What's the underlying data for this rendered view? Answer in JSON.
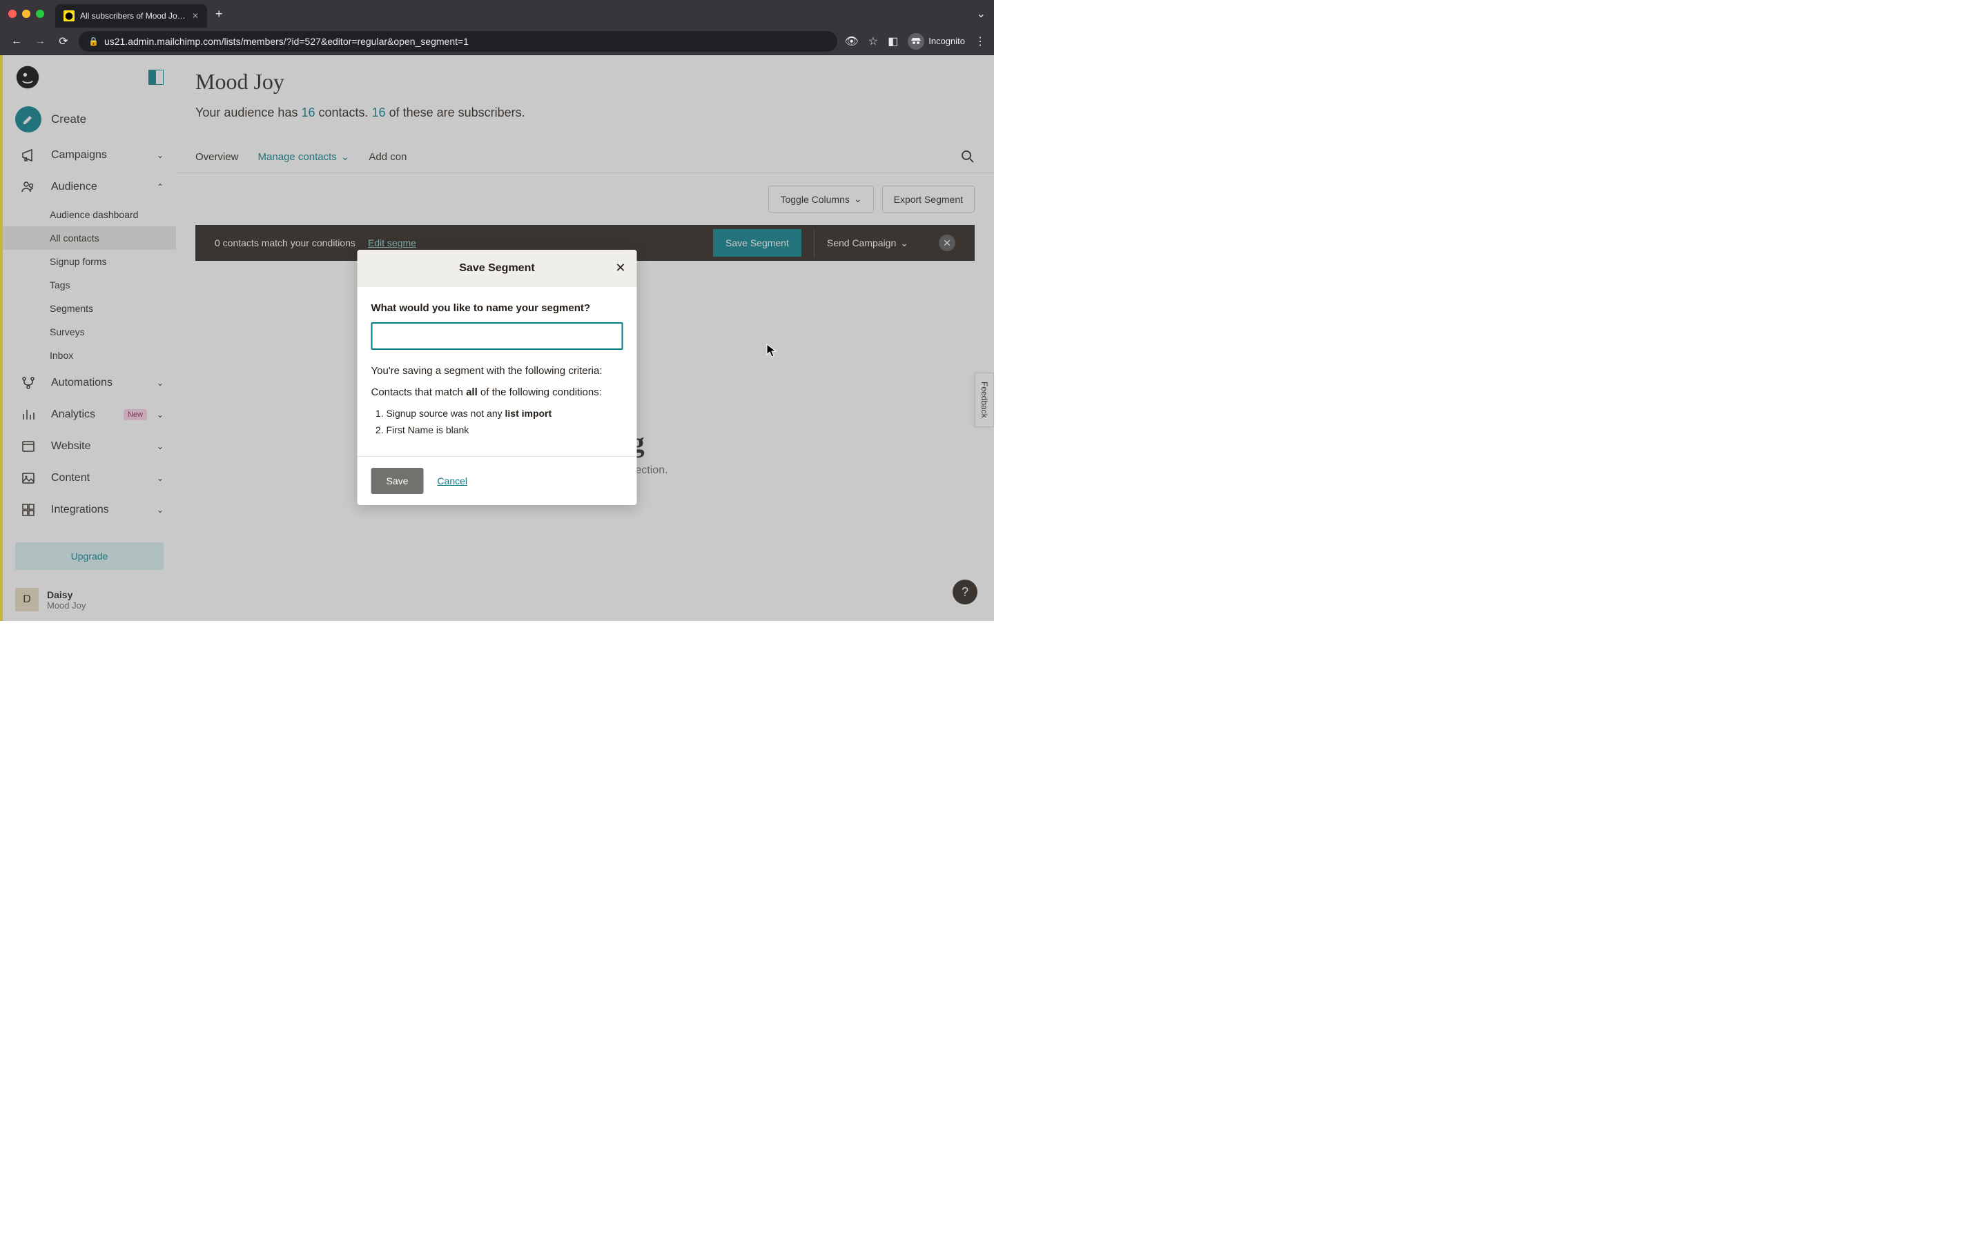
{
  "browser": {
    "tab_title": "All subscribers of Mood Joy | M",
    "url": "us21.admin.mailchimp.com/lists/members/?id=527&editor=regular&open_segment=1",
    "incognito_label": "Incognito"
  },
  "sidebar": {
    "create_label": "Create",
    "items": [
      {
        "label": "Campaigns"
      },
      {
        "label": "Audience"
      },
      {
        "label": "Automations"
      },
      {
        "label": "Analytics",
        "badge": "New"
      },
      {
        "label": "Website"
      },
      {
        "label": "Content"
      },
      {
        "label": "Integrations"
      }
    ],
    "audience_subnav": [
      {
        "label": "Audience dashboard"
      },
      {
        "label": "All contacts"
      },
      {
        "label": "Signup forms"
      },
      {
        "label": "Tags"
      },
      {
        "label": "Segments"
      },
      {
        "label": "Surveys"
      },
      {
        "label": "Inbox"
      }
    ],
    "upgrade_label": "Upgrade",
    "user_initial": "D",
    "user_name": "Daisy",
    "user_org": "Mood Joy"
  },
  "main": {
    "page_title": "Mood Joy",
    "audience_prefix": "Your audience has ",
    "contact_count": "16",
    "audience_mid": " contacts. ",
    "subscriber_count": "16",
    "audience_suffix": " of these are subscribers.",
    "tabs": {
      "overview": "Overview",
      "manage": "Manage contacts",
      "add": "Add con"
    },
    "toolbar": {
      "toggle_columns": "Toggle Columns",
      "export_segment": "Export Segment"
    },
    "darkbar": {
      "match_text": "0 contacts match your conditions",
      "edit_link": "Edit segme",
      "save_segment": "Save Segment",
      "send_campaign": "Send Campaign"
    },
    "empty": {
      "title": "Goose egg",
      "subtitle": "No contacts match your selection."
    }
  },
  "modal": {
    "title": "Save Segment",
    "question": "What would you like to name your segment?",
    "criteria_intro": "You're saving a segment with the following criteria:",
    "match_prefix": "Contacts that match ",
    "match_word": "all",
    "match_suffix": " of the following conditions:",
    "conditions": [
      {
        "prefix": "Signup source was not any ",
        "bold": "list import"
      },
      {
        "prefix": "First Name is blank",
        "bold": ""
      }
    ],
    "save_label": "Save",
    "cancel_label": "Cancel"
  },
  "feedback_label": "Feedback",
  "help_label": "?"
}
